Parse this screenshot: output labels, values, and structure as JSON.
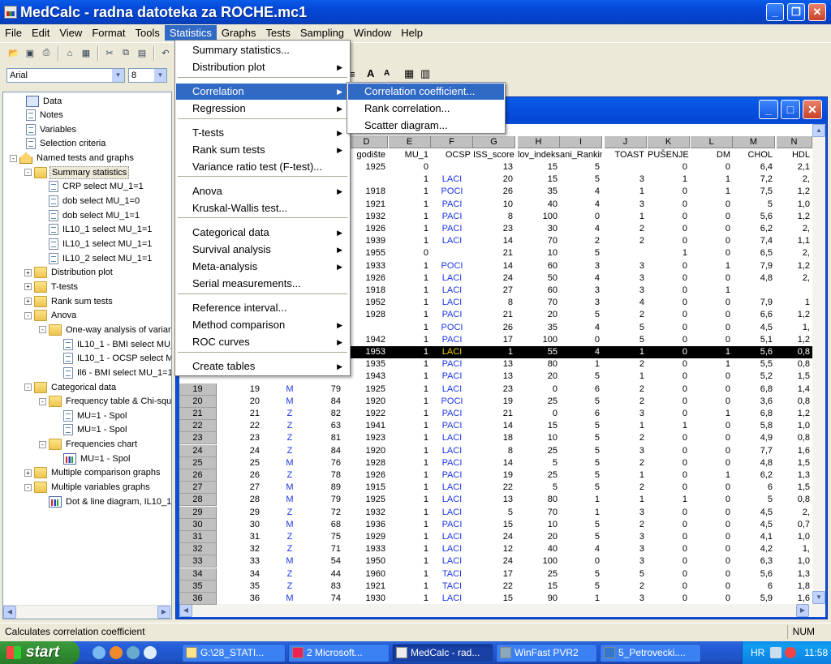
{
  "window": {
    "title": "MedCalc - radna datoteka za ROCHE.mc1"
  },
  "menubar": {
    "items": [
      "File",
      "Edit",
      "View",
      "Format",
      "Tools",
      "Statistics",
      "Graphs",
      "Tests",
      "Sampling",
      "Window",
      "Help"
    ],
    "active": "Statistics"
  },
  "format_bar": {
    "font": "Arial",
    "size": "8"
  },
  "tree": {
    "items": [
      {
        "label": "Data",
        "icon": "grid-icon"
      },
      {
        "label": "Notes",
        "icon": "document-icon"
      },
      {
        "label": "Variables",
        "icon": "document-icon"
      },
      {
        "label": "Selection criteria",
        "icon": "document-icon"
      },
      {
        "label": "Named tests and graphs",
        "icon": "home-icon"
      },
      {
        "label": "Summary statistics",
        "icon": "folder-icon"
      },
      {
        "label": "CRP select MU_1=1",
        "icon": "document-icon"
      },
      {
        "label": "dob select MU_1=0",
        "icon": "document-icon"
      },
      {
        "label": "dob select MU_1=1",
        "icon": "document-icon"
      },
      {
        "label": "IL10_1 select MU_1=1",
        "icon": "document-icon"
      },
      {
        "label": "IL10_1 select MU_1=1",
        "icon": "document-icon"
      },
      {
        "label": "IL10_2 select MU_1=1",
        "icon": "document-icon"
      },
      {
        "label": "Distribution plot",
        "icon": "folder-icon"
      },
      {
        "label": "T-tests",
        "icon": "folder-icon"
      },
      {
        "label": "Rank sum tests",
        "icon": "folder-icon"
      },
      {
        "label": "Anova",
        "icon": "folder-icon"
      },
      {
        "label": "One-way analysis of varianc",
        "icon": "folder-icon"
      },
      {
        "label": "IL10_1 - BMI select MU_",
        "icon": "document-icon"
      },
      {
        "label": "IL10_1 - OCSP select MU",
        "icon": "document-icon"
      },
      {
        "label": "Il6 - BMI select MU_1=1",
        "icon": "document-icon"
      },
      {
        "label": "Categorical data",
        "icon": "folder-icon"
      },
      {
        "label": "Frequency table & Chi-squa",
        "icon": "folder-icon"
      },
      {
        "label": "MU=1 - Spol",
        "icon": "document-icon"
      },
      {
        "label": "MU=1 - Spol",
        "icon": "document-icon"
      },
      {
        "label": "Frequencies chart",
        "icon": "folder-icon"
      },
      {
        "label": "MU=1 - Spol",
        "icon": "chart-icon"
      },
      {
        "label": "Multiple comparison graphs",
        "icon": "folder-icon"
      },
      {
        "label": "Multiple variables graphs",
        "icon": "folder-icon"
      },
      {
        "label": "Dot & line diagram, IL10_1, I",
        "icon": "chart-icon"
      }
    ]
  },
  "statistics_menu": {
    "items": [
      {
        "label": "Summary statistics...",
        "sub": false
      },
      {
        "label": "Distribution plot",
        "sub": true
      },
      {
        "label": "Correlation",
        "sub": true,
        "highlighted": true
      },
      {
        "label": "Regression",
        "sub": true
      },
      {
        "label": "T-tests",
        "sub": true
      },
      {
        "label": "Rank sum tests",
        "sub": true
      },
      {
        "label": "Variance ratio test (F-test)...",
        "sub": false
      },
      {
        "label": "Anova",
        "sub": true
      },
      {
        "label": "Kruskal-Wallis test...",
        "sub": false
      },
      {
        "label": "Categorical data",
        "sub": true
      },
      {
        "label": "Survival analysis",
        "sub": true
      },
      {
        "label": "Meta-analysis",
        "sub": true
      },
      {
        "label": "Serial measurements...",
        "sub": false
      },
      {
        "label": "Reference interval...",
        "sub": false
      },
      {
        "label": "Method comparison",
        "sub": true
      },
      {
        "label": "ROC curves",
        "sub": true
      },
      {
        "label": "Create tables",
        "sub": true
      }
    ]
  },
  "correlation_submenu": {
    "items": [
      "Correlation coefficient...",
      "Rank correlation...",
      "Scatter diagram..."
    ],
    "highlighted": "Correlation coefficient..."
  },
  "sheet": {
    "columns": [
      {
        "letter": "D",
        "name": "godište"
      },
      {
        "letter": "E",
        "name": "MU_1"
      },
      {
        "letter": "F",
        "name": "OCSP"
      },
      {
        "letter": "G",
        "name": "ISS_score"
      },
      {
        "letter": "H",
        "name": "lov_indeks"
      },
      {
        "letter": "I",
        "name": "ani_Rankin"
      },
      {
        "letter": "J",
        "name": "TOAST"
      },
      {
        "letter": "K",
        "name": "PUŠENJE"
      },
      {
        "letter": "L",
        "name": "DM"
      },
      {
        "letter": "M",
        "name": "CHOL"
      },
      {
        "letter": "N",
        "name": "HDL"
      }
    ],
    "top_rows": [
      [
        "1925",
        "0",
        "",
        "13",
        "15",
        "5",
        "",
        "0",
        "0",
        "6,4",
        "2,1"
      ],
      [
        "",
        "1",
        "LACI",
        "20",
        "15",
        "5",
        "3",
        "1",
        "1",
        "7,2",
        "2,"
      ],
      [
        "1918",
        "1",
        "POCI",
        "26",
        "35",
        "4",
        "1",
        "0",
        "1",
        "7,5",
        "1,2"
      ],
      [
        "1921",
        "1",
        "PACI",
        "10",
        "40",
        "4",
        "3",
        "0",
        "0",
        "5",
        "1,0"
      ],
      [
        "1932",
        "1",
        "PACI",
        "8",
        "100",
        "0",
        "1",
        "0",
        "0",
        "5,6",
        "1,2"
      ],
      [
        "1926",
        "1",
        "PACI",
        "23",
        "30",
        "4",
        "2",
        "0",
        "0",
        "6,2",
        "2,"
      ],
      [
        "1939",
        "1",
        "LACI",
        "14",
        "70",
        "2",
        "2",
        "0",
        "0",
        "7,4",
        "1,1"
      ],
      [
        "1955",
        "0",
        "",
        "21",
        "10",
        "5",
        "",
        "1",
        "0",
        "6,5",
        "2,"
      ],
      [
        "1933",
        "1",
        "POCI",
        "14",
        "60",
        "3",
        "3",
        "0",
        "1",
        "7,9",
        "1,2"
      ],
      [
        "1926",
        "1",
        "LACI",
        "24",
        "50",
        "4",
        "3",
        "0",
        "0",
        "4,8",
        "2,"
      ],
      [
        "1918",
        "1",
        "LACI",
        "27",
        "60",
        "3",
        "3",
        "0",
        "1",
        "",
        ""
      ],
      [
        "1952",
        "1",
        "LACI",
        "8",
        "70",
        "3",
        "4",
        "0",
        "0",
        "7,9",
        "1"
      ],
      [
        "1928",
        "1",
        "PACI",
        "21",
        "20",
        "5",
        "2",
        "0",
        "0",
        "6,6",
        "1,2"
      ],
      [
        "",
        "1",
        "POCI",
        "26",
        "35",
        "4",
        "5",
        "0",
        "0",
        "4,5",
        "1,"
      ],
      [
        "1942",
        "1",
        "PACI",
        "17",
        "100",
        "0",
        "5",
        "0",
        "0",
        "5,1",
        "1,2"
      ],
      [
        "1953",
        "1",
        "LACI",
        "1",
        "55",
        "4",
        "1",
        "0",
        "1",
        "5,6",
        "0,8"
      ],
      [
        "1935",
        "1",
        "PACI",
        "13",
        "80",
        "1",
        "2",
        "0",
        "1",
        "5,5",
        "0,8"
      ],
      [
        "1943",
        "1",
        "PACI",
        "13",
        "20",
        "5",
        "1",
        "0",
        "0",
        "5,2",
        "1,5"
      ]
    ],
    "rows": [
      [
        "19",
        "19",
        "M",
        "79",
        "1925",
        "1",
        "LACI",
        "23",
        "0",
        "6",
        "2",
        "0",
        "0",
        "6,8",
        "1,4"
      ],
      [
        "20",
        "20",
        "M",
        "84",
        "1920",
        "1",
        "POCI",
        "19",
        "25",
        "5",
        "2",
        "0",
        "0",
        "3,6",
        "0,8"
      ],
      [
        "21",
        "21",
        "Z",
        "82",
        "1922",
        "1",
        "PACI",
        "21",
        "0",
        "6",
        "3",
        "0",
        "1",
        "6,8",
        "1,2"
      ],
      [
        "22",
        "22",
        "Z",
        "63",
        "1941",
        "1",
        "PACI",
        "14",
        "15",
        "5",
        "1",
        "1",
        "0",
        "5,8",
        "1,0"
      ],
      [
        "23",
        "23",
        "Z",
        "81",
        "1923",
        "1",
        "LACI",
        "18",
        "10",
        "5",
        "2",
        "0",
        "0",
        "4,9",
        "0,8"
      ],
      [
        "24",
        "24",
        "Z",
        "84",
        "1920",
        "1",
        "LACI",
        "8",
        "25",
        "5",
        "3",
        "0",
        "0",
        "7,7",
        "1,6"
      ],
      [
        "25",
        "25",
        "M",
        "76",
        "1928",
        "1",
        "PACI",
        "14",
        "5",
        "5",
        "2",
        "0",
        "0",
        "4,8",
        "1,5"
      ],
      [
        "26",
        "26",
        "Z",
        "78",
        "1926",
        "1",
        "PACI",
        "19",
        "25",
        "5",
        "1",
        "0",
        "1",
        "6,2",
        "1,3"
      ],
      [
        "27",
        "27",
        "M",
        "89",
        "1915",
        "1",
        "LACI",
        "22",
        "5",
        "5",
        "2",
        "0",
        "0",
        "6",
        "1,5"
      ],
      [
        "28",
        "28",
        "M",
        "79",
        "1925",
        "1",
        "LACI",
        "13",
        "80",
        "1",
        "1",
        "1",
        "0",
        "5",
        "0,8"
      ],
      [
        "29",
        "29",
        "Z",
        "72",
        "1932",
        "1",
        "LACI",
        "5",
        "70",
        "1",
        "3",
        "0",
        "0",
        "4,5",
        "2,"
      ],
      [
        "30",
        "30",
        "M",
        "68",
        "1936",
        "1",
        "PACI",
        "15",
        "10",
        "5",
        "2",
        "0",
        "0",
        "4,5",
        "0,7"
      ],
      [
        "31",
        "31",
        "Z",
        "75",
        "1929",
        "1",
        "LACI",
        "24",
        "20",
        "5",
        "3",
        "0",
        "0",
        "4,1",
        "1,0"
      ],
      [
        "32",
        "32",
        "Z",
        "71",
        "1933",
        "1",
        "LACI",
        "12",
        "40",
        "4",
        "3",
        "0",
        "0",
        "4,2",
        "1,"
      ],
      [
        "33",
        "33",
        "M",
        "54",
        "1950",
        "1",
        "LACI",
        "24",
        "100",
        "0",
        "3",
        "0",
        "0",
        "6,3",
        "1,0"
      ],
      [
        "34",
        "34",
        "Z",
        "44",
        "1960",
        "1",
        "TACI",
        "17",
        "25",
        "5",
        "5",
        "0",
        "0",
        "5,6",
        "1,3"
      ],
      [
        "35",
        "35",
        "Z",
        "83",
        "1921",
        "1",
        "TACI",
        "22",
        "15",
        "5",
        "2",
        "0",
        "0",
        "6",
        "1,8"
      ],
      [
        "36",
        "36",
        "M",
        "74",
        "1930",
        "1",
        "LACI",
        "15",
        "90",
        "1",
        "3",
        "0",
        "0",
        "5,9",
        "1,6"
      ]
    ]
  },
  "status": {
    "text": "Calculates correlation coefficient",
    "num": "NUM"
  },
  "taskbar": {
    "start": "start",
    "buttons": [
      "G:\\28_STATI...",
      "2 Microsoft...",
      "MedCalc - rad...",
      "WinFast PVR2",
      "5_Petrovecki...."
    ],
    "active": "MedCalc - rad...",
    "lang": "HR",
    "clock": "11:58"
  }
}
